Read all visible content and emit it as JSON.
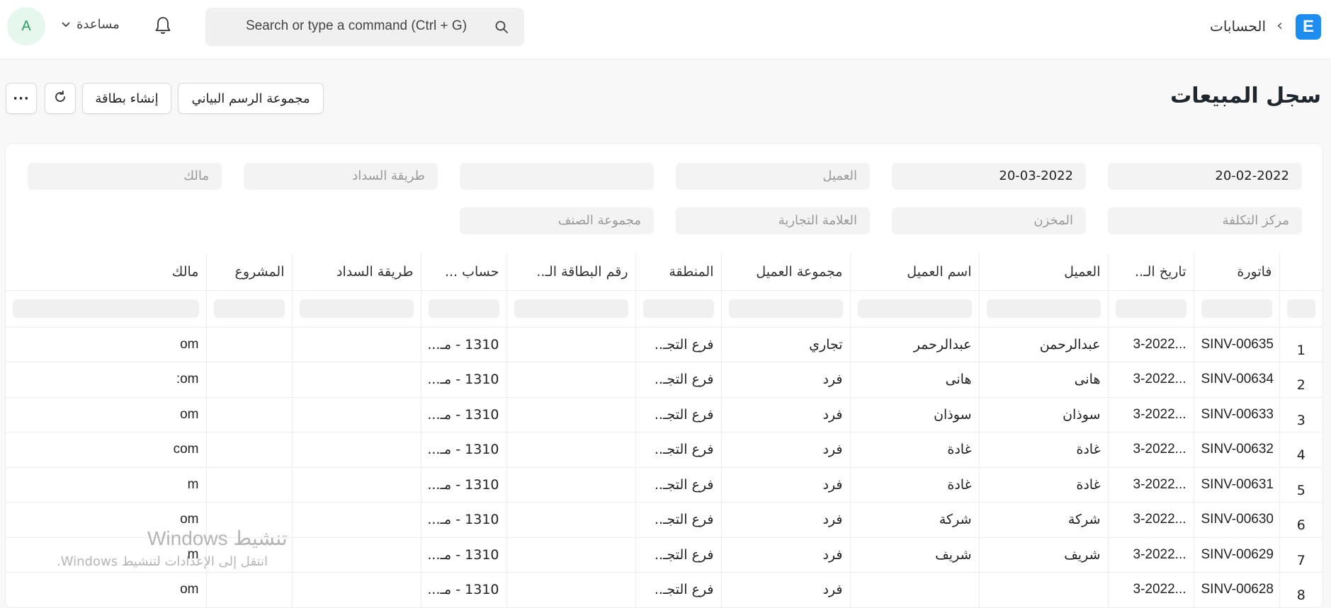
{
  "navbar": {
    "logo_letter": "E",
    "breadcrumb": "الحسابات",
    "search_placeholder": "Search or type a command (Ctrl + G)",
    "help_label": "مساعدة",
    "avatar_letter": "A"
  },
  "page": {
    "title": "سجل المبيعات",
    "buttons": {
      "chart_group": "مجموعة الرسم البياني",
      "new_card": "إنشاء بطاقة",
      "more": "···"
    }
  },
  "filters": {
    "row1": [
      {
        "value": "20-02-2022",
        "placeholder": ""
      },
      {
        "value": "20-03-2022",
        "placeholder": ""
      },
      {
        "value": "",
        "placeholder": "العميل"
      },
      {
        "value": "",
        "placeholder": ""
      },
      {
        "value": "",
        "placeholder": "طريقة السداد"
      },
      {
        "value": "",
        "placeholder": "مالك"
      }
    ],
    "row2": [
      {
        "value": "",
        "placeholder": "مركز التكلفة"
      },
      {
        "value": "",
        "placeholder": "المخزن"
      },
      {
        "value": "",
        "placeholder": "العلامة التجارية"
      },
      {
        "value": "",
        "placeholder": "مجموعة الصنف"
      }
    ]
  },
  "table": {
    "columns": [
      "",
      "فاتورة",
      "تاريخ الـ..",
      "العميل",
      "اسم العميل",
      "مجموعة العميل",
      "المنطقة",
      "رقم البطاقة الـ..",
      "حساب ...",
      "طريقة السداد",
      "المشروع",
      "مالك"
    ],
    "rows": [
      {
        "idx": "1",
        "invoice": "SINV-00635",
        "date": "3-2022...",
        "customer": "عبدالرحمن",
        "customer_name": "عبدالرحمر",
        "group": "تجاري",
        "territory": "فرع التجـ..",
        "card": "",
        "account": "1310 - مـ...",
        "payment": "",
        "project": "",
        "owner": "om"
      },
      {
        "idx": "2",
        "invoice": "SINV-00634",
        "date": "3-2022...",
        "customer": "هانى",
        "customer_name": "هانى",
        "group": "فرد",
        "territory": "فرع التجـ..",
        "card": "",
        "account": "1310 - مـ...",
        "payment": "",
        "project": "",
        "owner": ":om"
      },
      {
        "idx": "3",
        "invoice": "SINV-00633",
        "date": "3-2022...",
        "customer": "سوذان",
        "customer_name": "سوذان",
        "group": "فرد",
        "territory": "فرع التجـ..",
        "card": "",
        "account": "1310 - مـ...",
        "payment": "",
        "project": "",
        "owner": "om"
      },
      {
        "idx": "4",
        "invoice": "SINV-00632",
        "date": "3-2022...",
        "customer": "غادة",
        "customer_name": "غادة",
        "group": "فرد",
        "territory": "فرع التجـ..",
        "card": "",
        "account": "1310 - مـ...",
        "payment": "",
        "project": "",
        "owner": "com"
      },
      {
        "idx": "5",
        "invoice": "SINV-00631",
        "date": "3-2022...",
        "customer": "غادة",
        "customer_name": "غادة",
        "group": "فرد",
        "territory": "فرع التجـ..",
        "card": "",
        "account": "1310 - مـ...",
        "payment": "",
        "project": "",
        "owner": "m"
      },
      {
        "idx": "6",
        "invoice": "SINV-00630",
        "date": "3-2022...",
        "customer": "شركة",
        "customer_name": "شركة",
        "group": "فرد",
        "territory": "فرع التجـ..",
        "card": "",
        "account": "1310 - مـ...",
        "payment": "",
        "project": "",
        "owner": "om"
      },
      {
        "idx": "7",
        "invoice": "SINV-00629",
        "date": "3-2022...",
        "customer": "شريف",
        "customer_name": "شريف",
        "group": "فرد",
        "territory": "فرع التجـ..",
        "card": "",
        "account": "1310 - مـ...",
        "payment": "",
        "project": "",
        "owner": "m"
      },
      {
        "idx": "8",
        "invoice": "SINV-00628",
        "date": "3-2022...",
        "customer": "",
        "customer_name": "",
        "group": "فرد",
        "territory": "فرع التجـ..",
        "card": "",
        "account": "1310 - مـ...",
        "payment": "",
        "project": "",
        "owner": "om"
      }
    ]
  },
  "watermark": {
    "line1": "تنشيط Windows",
    "line2": "انتقل إلى الإعدادات لتنشيط Windows."
  }
}
